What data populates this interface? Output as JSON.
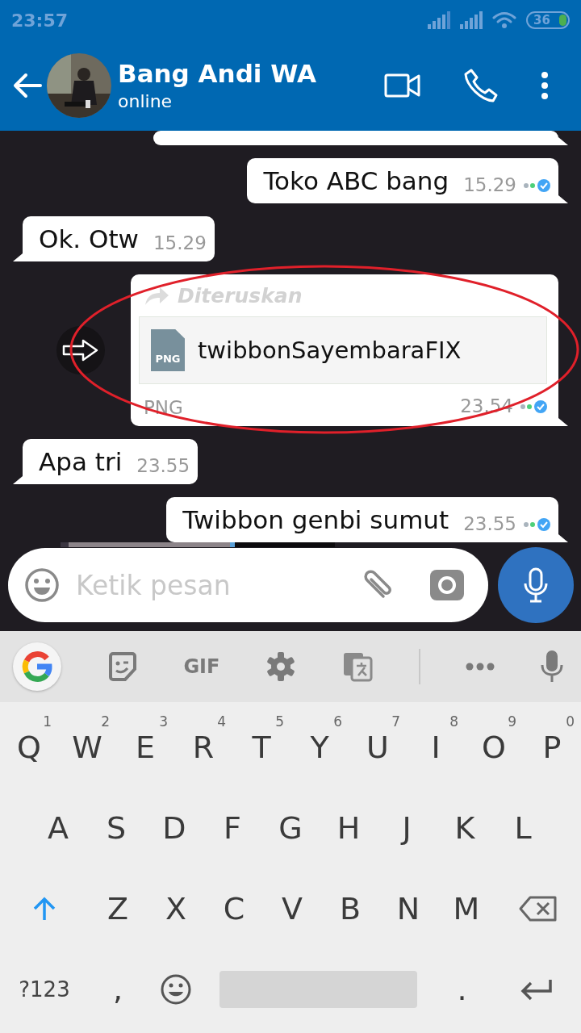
{
  "status_bar": {
    "time": "23:57",
    "battery": "36"
  },
  "header": {
    "contact_name": "Bang Andi WA",
    "status": "online"
  },
  "messages": [
    {
      "kind": "partial",
      "outgoing": true
    },
    {
      "kind": "text",
      "outgoing": true,
      "text": "Toko ABC bang",
      "time": "15.29",
      "read": true
    },
    {
      "kind": "text",
      "outgoing": false,
      "text": "Ok. Otw",
      "time": "15.29"
    },
    {
      "kind": "file",
      "outgoing": true,
      "forwarded_label": "Diteruskan",
      "file_badge": "PNG",
      "file_name": "twibbonSayembaraFIX",
      "file_type": "PNG",
      "time": "23.54",
      "read": true,
      "highlighted": true
    },
    {
      "kind": "text",
      "outgoing": false,
      "text": "Apa tri",
      "time": "23.55"
    },
    {
      "kind": "text",
      "outgoing": true,
      "text": "Twibbon genbi sumut",
      "time": "23.55",
      "read": true
    },
    {
      "kind": "picture",
      "outgoing": false
    }
  ],
  "composer": {
    "placeholder": "Ketik pesan"
  },
  "keyboard_toolbar": {
    "gif_label": "GIF"
  },
  "keyboard_rows": [
    [
      {
        "kind": "letter",
        "label": "Q",
        "hint": "1"
      },
      {
        "kind": "letter",
        "label": "W",
        "hint": "2"
      },
      {
        "kind": "letter",
        "label": "E",
        "hint": "3"
      },
      {
        "kind": "letter",
        "label": "R",
        "hint": "4"
      },
      {
        "kind": "letter",
        "label": "T",
        "hint": "5"
      },
      {
        "kind": "letter",
        "label": "Y",
        "hint": "6"
      },
      {
        "kind": "letter",
        "label": "U",
        "hint": "7"
      },
      {
        "kind": "letter",
        "label": "I",
        "hint": "8"
      },
      {
        "kind": "letter",
        "label": "O",
        "hint": "9"
      },
      {
        "kind": "letter",
        "label": "P",
        "hint": "0"
      }
    ],
    [
      {
        "kind": "letter",
        "label": "A"
      },
      {
        "kind": "letter",
        "label": "S"
      },
      {
        "kind": "letter",
        "label": "D"
      },
      {
        "kind": "letter",
        "label": "F"
      },
      {
        "kind": "letter",
        "label": "G"
      },
      {
        "kind": "letter",
        "label": "H"
      },
      {
        "kind": "letter",
        "label": "J"
      },
      {
        "kind": "letter",
        "label": "K"
      },
      {
        "kind": "letter",
        "label": "L"
      }
    ],
    [
      {
        "kind": "shift"
      },
      {
        "kind": "letter",
        "label": "Z"
      },
      {
        "kind": "letter",
        "label": "X"
      },
      {
        "kind": "letter",
        "label": "C"
      },
      {
        "kind": "letter",
        "label": "V"
      },
      {
        "kind": "letter",
        "label": "B"
      },
      {
        "kind": "letter",
        "label": "N"
      },
      {
        "kind": "letter",
        "label": "M"
      },
      {
        "kind": "backspace"
      }
    ],
    [
      {
        "kind": "symbols",
        "label": "?123"
      },
      {
        "kind": "letter",
        "label": ","
      },
      {
        "kind": "emoji"
      },
      {
        "kind": "space"
      },
      {
        "kind": "letter",
        "label": "."
      },
      {
        "kind": "enter"
      }
    ]
  ]
}
